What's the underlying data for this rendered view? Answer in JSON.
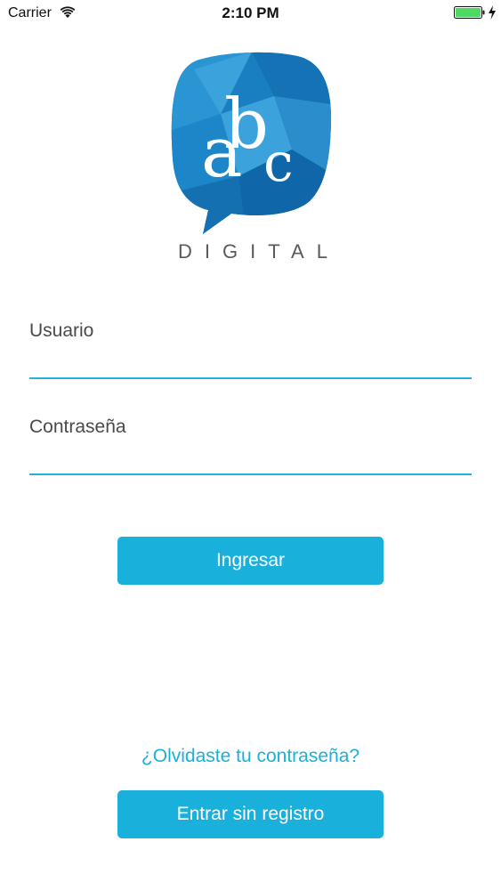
{
  "status_bar": {
    "carrier": "Carrier",
    "time": "2:10 PM",
    "icons": [
      "wifi-icon",
      "battery-icon",
      "charging-icon"
    ],
    "battery_color": "#4cd964"
  },
  "logo": {
    "letters": "abc",
    "wordmark": "DIGITAL",
    "brand_color": "#1a7fc1"
  },
  "form": {
    "username_label": "Usuario",
    "username_value": "",
    "password_label": "Contraseña",
    "password_value": "",
    "accent_color": "#22b2dd"
  },
  "actions": {
    "login_label": "Ingresar",
    "forgot_label": "¿Olvidaste tu contraseña?",
    "guest_label": "Entrar sin registro",
    "button_color": "#19b0dc"
  }
}
